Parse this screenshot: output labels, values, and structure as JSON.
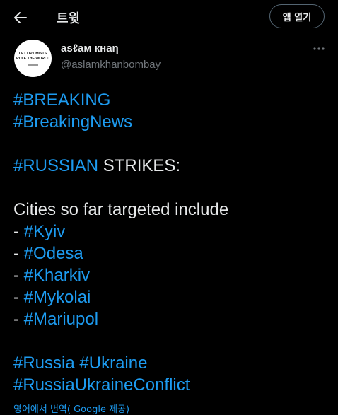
{
  "header": {
    "title": "트윗",
    "open_app_label": "앱 열기"
  },
  "author": {
    "display_name": "asℓaм кнaη",
    "handle": "@aslamkhanbombay",
    "avatar_text_line1": "LET OPTIMISTS",
    "avatar_text_line2": "RULE THE WORLD"
  },
  "tweet": {
    "breaking": "#BREAKING",
    "breaking_news": "#BreakingNews",
    "russian": "#RUSSIAN",
    "strikes": " STRIKES:",
    "cities_intro": "Cities so far targeted include",
    "dash": "- ",
    "cities": [
      "#Kyiv",
      "#Odesa",
      "#Kharkiv",
      "#Mykolai",
      "#Mariupol"
    ],
    "tag_russia": "#Russia",
    "tag_ukraine": "#Ukraine",
    "tag_conflict": "#RussiaUkraineConflict"
  },
  "translate_text": "영어에서 번역( Google 제공)",
  "colors": {
    "background": "#000000",
    "text": "#e7e9ea",
    "link": "#1d9bf0",
    "muted": "#71767b"
  }
}
